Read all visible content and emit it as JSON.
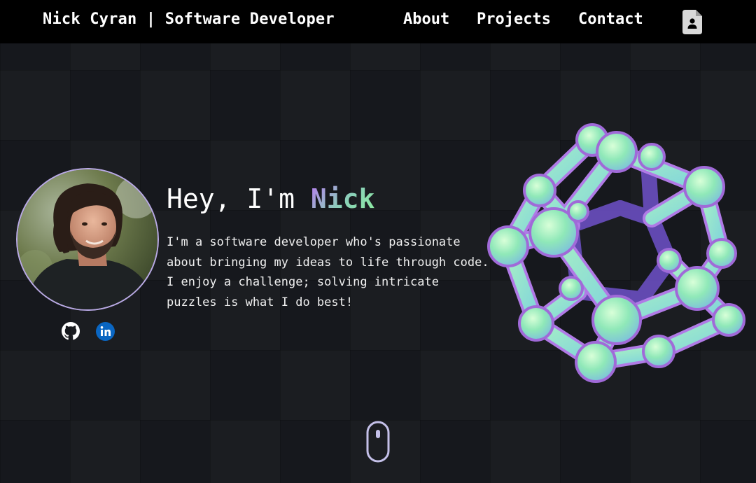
{
  "navbar": {
    "brand": "Nick Cyran | Software Developer",
    "links": [
      {
        "label": "About"
      },
      {
        "label": "Projects"
      },
      {
        "label": "Contact"
      }
    ],
    "resume_icon": "document-person-icon"
  },
  "hero": {
    "greeting_prefix": "Hey, I'm ",
    "greeting_name": "Nick",
    "intro": "I'm a software developer who's passionate about bringing my ideas to life through code. I enjoy a challenge; solving intricate puzzles is what I do best!",
    "avatar_icon": "profile-photo",
    "socials": [
      {
        "icon": "github-icon"
      },
      {
        "icon": "linkedin-icon"
      }
    ],
    "shape_icon": "dodecahedron-graphic",
    "scroll_icon": "mouse-scroll-icon"
  },
  "colors": {
    "background": "#16181d",
    "navbar": "#000000",
    "accent_purple": "#b77cf0",
    "accent_green": "#8ef0a0",
    "linkedin_blue": "#0a66c2"
  }
}
